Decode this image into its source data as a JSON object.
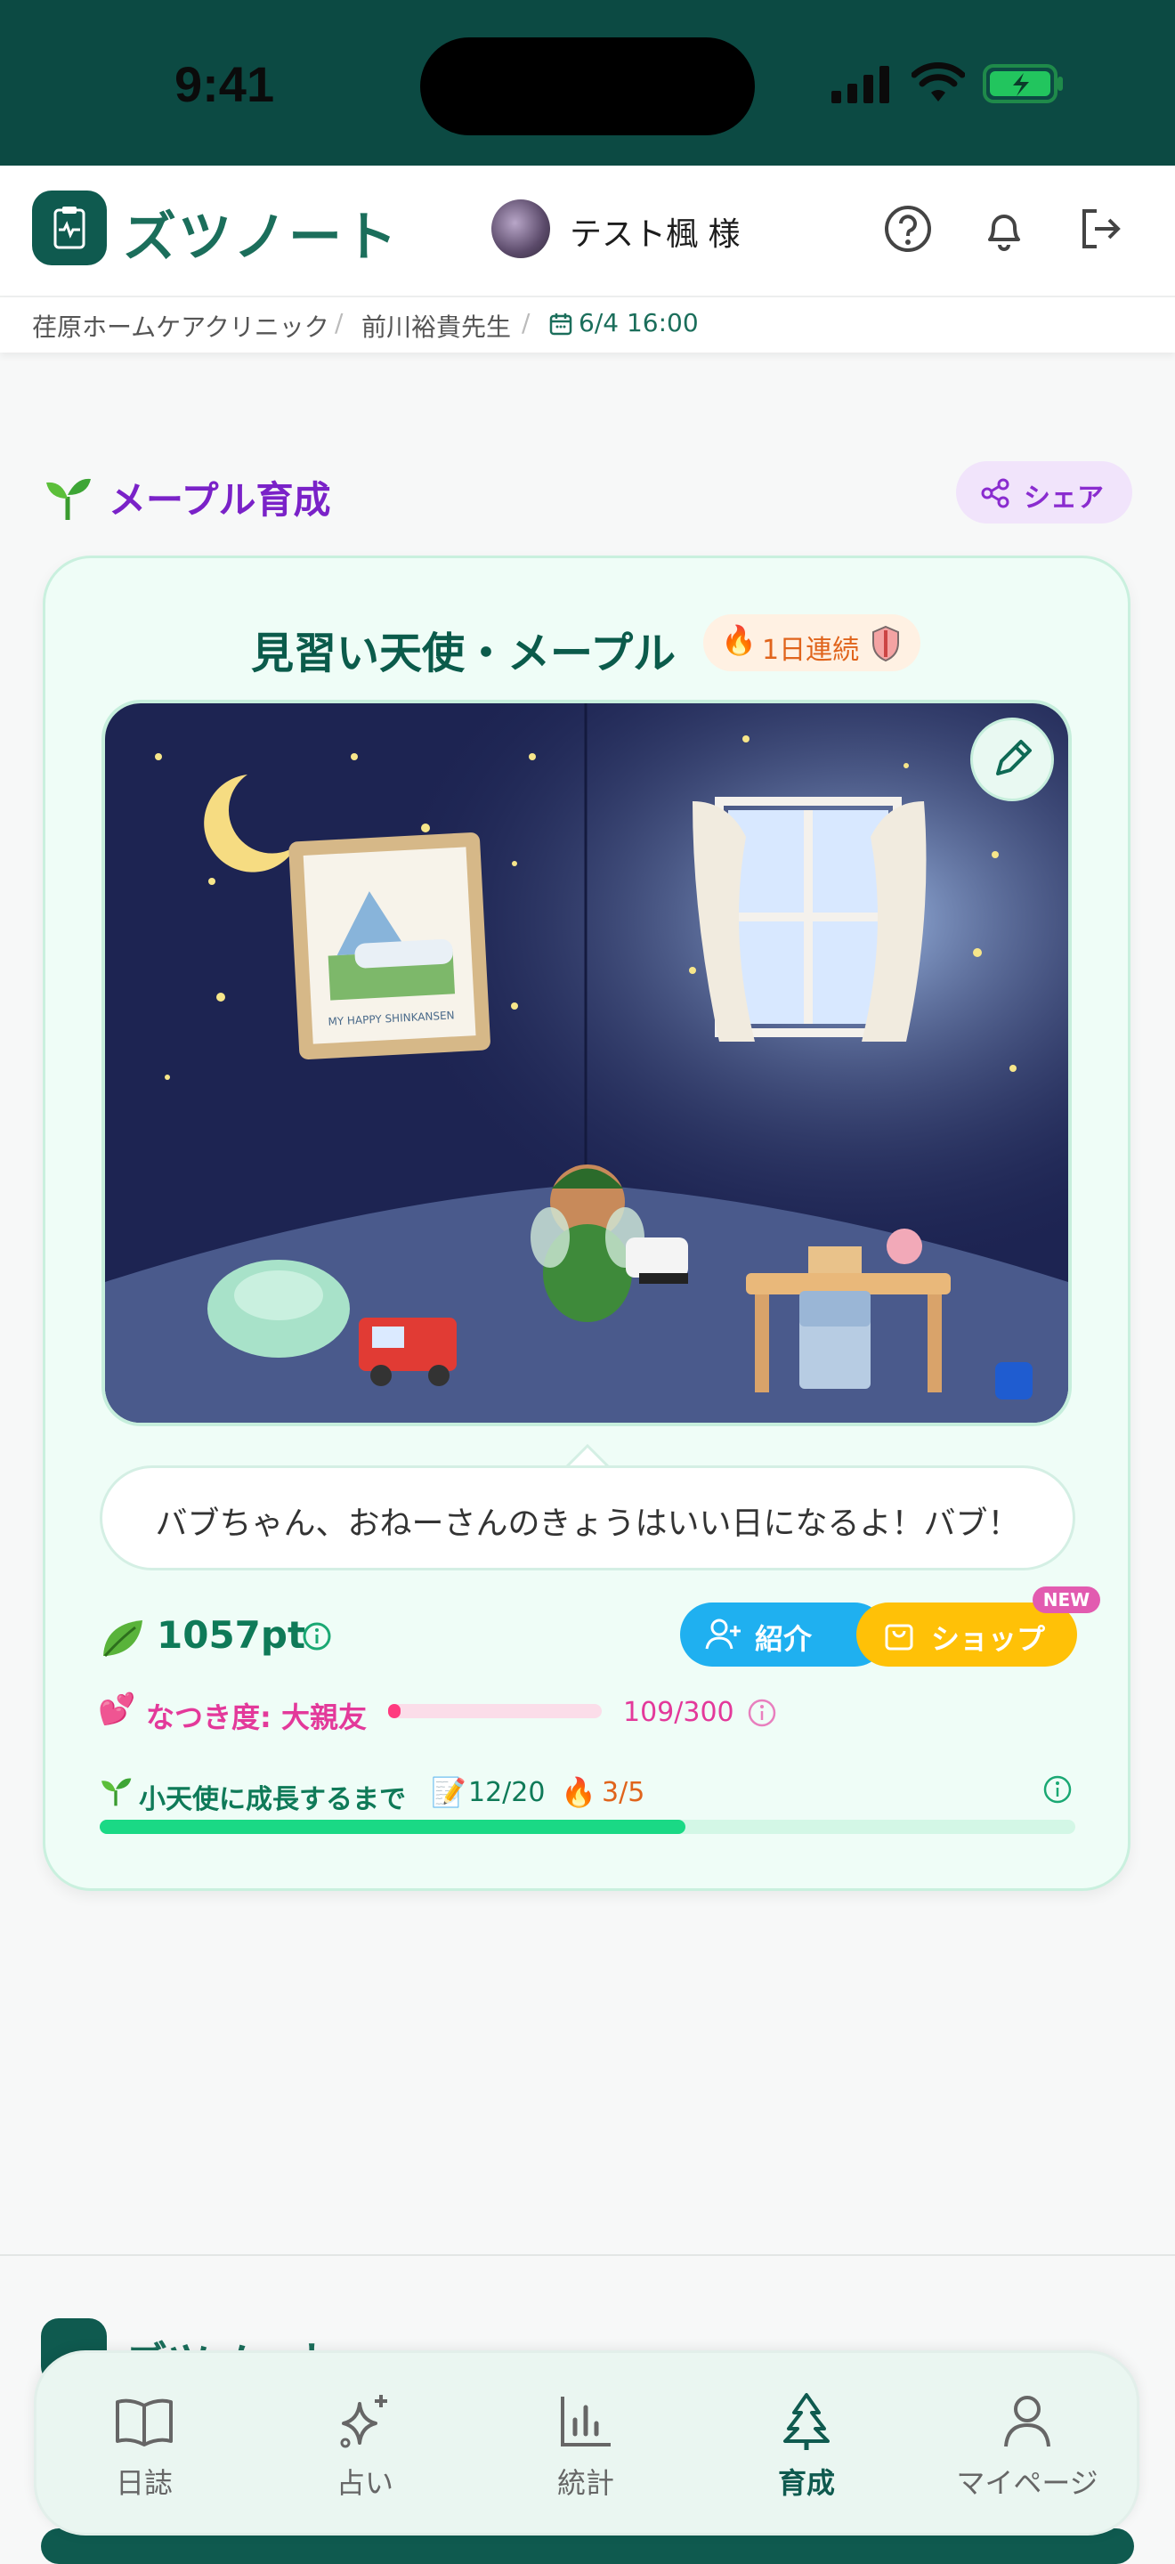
{
  "status_bar": {
    "time": "9:41"
  },
  "header": {
    "app_title": "ズツノート",
    "user_name": "テスト楓 様",
    "icons": [
      "help-icon",
      "bell-icon",
      "logout-icon"
    ]
  },
  "breadcrumb": {
    "clinic": "荏原ホームケアクリニック",
    "doctor": "前川裕貴先生",
    "appointment": "6/4 16:00"
  },
  "section": {
    "title": "メープル育成",
    "share_label": "シェア"
  },
  "character": {
    "title": "見習い天使・メープル",
    "streak": "1日連続",
    "painting_caption": "MY HAPPY SHINKANSEN",
    "speech": "バブちゃん、おねーさんのきょうはいい日になるよ！バブ！"
  },
  "points": {
    "value": "1057pt",
    "intro_label": "紹介",
    "shop_label": "ショップ",
    "new_badge": "NEW"
  },
  "affection": {
    "label": "なつき度: 大親友",
    "value": "109/300",
    "current": 109,
    "max": 300
  },
  "growth": {
    "label": "小天使に成長するまで",
    "diary_count": "12/20",
    "fire_count": "3/5",
    "progress": 0.6
  },
  "footer": {
    "title": "ズツノート"
  },
  "nav": {
    "items": [
      {
        "label": "日誌",
        "icon": "book-icon"
      },
      {
        "label": "占い",
        "icon": "sparkle-icon"
      },
      {
        "label": "統計",
        "icon": "chart-icon"
      },
      {
        "label": "育成",
        "icon": "tree-icon",
        "active": true
      },
      {
        "label": "マイページ",
        "icon": "user-icon"
      }
    ]
  },
  "colors": {
    "brand": "#0f5a4f",
    "accent_purple": "#7a22c8",
    "pink": "#e3399a",
    "green": "#1ad985"
  }
}
